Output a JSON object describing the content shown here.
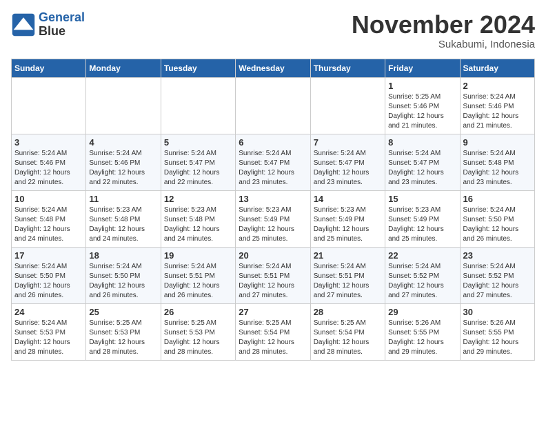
{
  "header": {
    "logo_line1": "General",
    "logo_line2": "Blue",
    "month": "November 2024",
    "location": "Sukabumi, Indonesia"
  },
  "weekdays": [
    "Sunday",
    "Monday",
    "Tuesday",
    "Wednesday",
    "Thursday",
    "Friday",
    "Saturday"
  ],
  "weeks": [
    [
      {
        "day": "",
        "info": ""
      },
      {
        "day": "",
        "info": ""
      },
      {
        "day": "",
        "info": ""
      },
      {
        "day": "",
        "info": ""
      },
      {
        "day": "",
        "info": ""
      },
      {
        "day": "1",
        "info": "Sunrise: 5:25 AM\nSunset: 5:46 PM\nDaylight: 12 hours\nand 21 minutes."
      },
      {
        "day": "2",
        "info": "Sunrise: 5:24 AM\nSunset: 5:46 PM\nDaylight: 12 hours\nand 21 minutes."
      }
    ],
    [
      {
        "day": "3",
        "info": "Sunrise: 5:24 AM\nSunset: 5:46 PM\nDaylight: 12 hours\nand 22 minutes."
      },
      {
        "day": "4",
        "info": "Sunrise: 5:24 AM\nSunset: 5:46 PM\nDaylight: 12 hours\nand 22 minutes."
      },
      {
        "day": "5",
        "info": "Sunrise: 5:24 AM\nSunset: 5:47 PM\nDaylight: 12 hours\nand 22 minutes."
      },
      {
        "day": "6",
        "info": "Sunrise: 5:24 AM\nSunset: 5:47 PM\nDaylight: 12 hours\nand 23 minutes."
      },
      {
        "day": "7",
        "info": "Sunrise: 5:24 AM\nSunset: 5:47 PM\nDaylight: 12 hours\nand 23 minutes."
      },
      {
        "day": "8",
        "info": "Sunrise: 5:24 AM\nSunset: 5:47 PM\nDaylight: 12 hours\nand 23 minutes."
      },
      {
        "day": "9",
        "info": "Sunrise: 5:24 AM\nSunset: 5:48 PM\nDaylight: 12 hours\nand 23 minutes."
      }
    ],
    [
      {
        "day": "10",
        "info": "Sunrise: 5:24 AM\nSunset: 5:48 PM\nDaylight: 12 hours\nand 24 minutes."
      },
      {
        "day": "11",
        "info": "Sunrise: 5:23 AM\nSunset: 5:48 PM\nDaylight: 12 hours\nand 24 minutes."
      },
      {
        "day": "12",
        "info": "Sunrise: 5:23 AM\nSunset: 5:48 PM\nDaylight: 12 hours\nand 24 minutes."
      },
      {
        "day": "13",
        "info": "Sunrise: 5:23 AM\nSunset: 5:49 PM\nDaylight: 12 hours\nand 25 minutes."
      },
      {
        "day": "14",
        "info": "Sunrise: 5:23 AM\nSunset: 5:49 PM\nDaylight: 12 hours\nand 25 minutes."
      },
      {
        "day": "15",
        "info": "Sunrise: 5:23 AM\nSunset: 5:49 PM\nDaylight: 12 hours\nand 25 minutes."
      },
      {
        "day": "16",
        "info": "Sunrise: 5:24 AM\nSunset: 5:50 PM\nDaylight: 12 hours\nand 26 minutes."
      }
    ],
    [
      {
        "day": "17",
        "info": "Sunrise: 5:24 AM\nSunset: 5:50 PM\nDaylight: 12 hours\nand 26 minutes."
      },
      {
        "day": "18",
        "info": "Sunrise: 5:24 AM\nSunset: 5:50 PM\nDaylight: 12 hours\nand 26 minutes."
      },
      {
        "day": "19",
        "info": "Sunrise: 5:24 AM\nSunset: 5:51 PM\nDaylight: 12 hours\nand 26 minutes."
      },
      {
        "day": "20",
        "info": "Sunrise: 5:24 AM\nSunset: 5:51 PM\nDaylight: 12 hours\nand 27 minutes."
      },
      {
        "day": "21",
        "info": "Sunrise: 5:24 AM\nSunset: 5:51 PM\nDaylight: 12 hours\nand 27 minutes."
      },
      {
        "day": "22",
        "info": "Sunrise: 5:24 AM\nSunset: 5:52 PM\nDaylight: 12 hours\nand 27 minutes."
      },
      {
        "day": "23",
        "info": "Sunrise: 5:24 AM\nSunset: 5:52 PM\nDaylight: 12 hours\nand 27 minutes."
      }
    ],
    [
      {
        "day": "24",
        "info": "Sunrise: 5:24 AM\nSunset: 5:53 PM\nDaylight: 12 hours\nand 28 minutes."
      },
      {
        "day": "25",
        "info": "Sunrise: 5:25 AM\nSunset: 5:53 PM\nDaylight: 12 hours\nand 28 minutes."
      },
      {
        "day": "26",
        "info": "Sunrise: 5:25 AM\nSunset: 5:53 PM\nDaylight: 12 hours\nand 28 minutes."
      },
      {
        "day": "27",
        "info": "Sunrise: 5:25 AM\nSunset: 5:54 PM\nDaylight: 12 hours\nand 28 minutes."
      },
      {
        "day": "28",
        "info": "Sunrise: 5:25 AM\nSunset: 5:54 PM\nDaylight: 12 hours\nand 28 minutes."
      },
      {
        "day": "29",
        "info": "Sunrise: 5:26 AM\nSunset: 5:55 PM\nDaylight: 12 hours\nand 29 minutes."
      },
      {
        "day": "30",
        "info": "Sunrise: 5:26 AM\nSunset: 5:55 PM\nDaylight: 12 hours\nand 29 minutes."
      }
    ]
  ]
}
